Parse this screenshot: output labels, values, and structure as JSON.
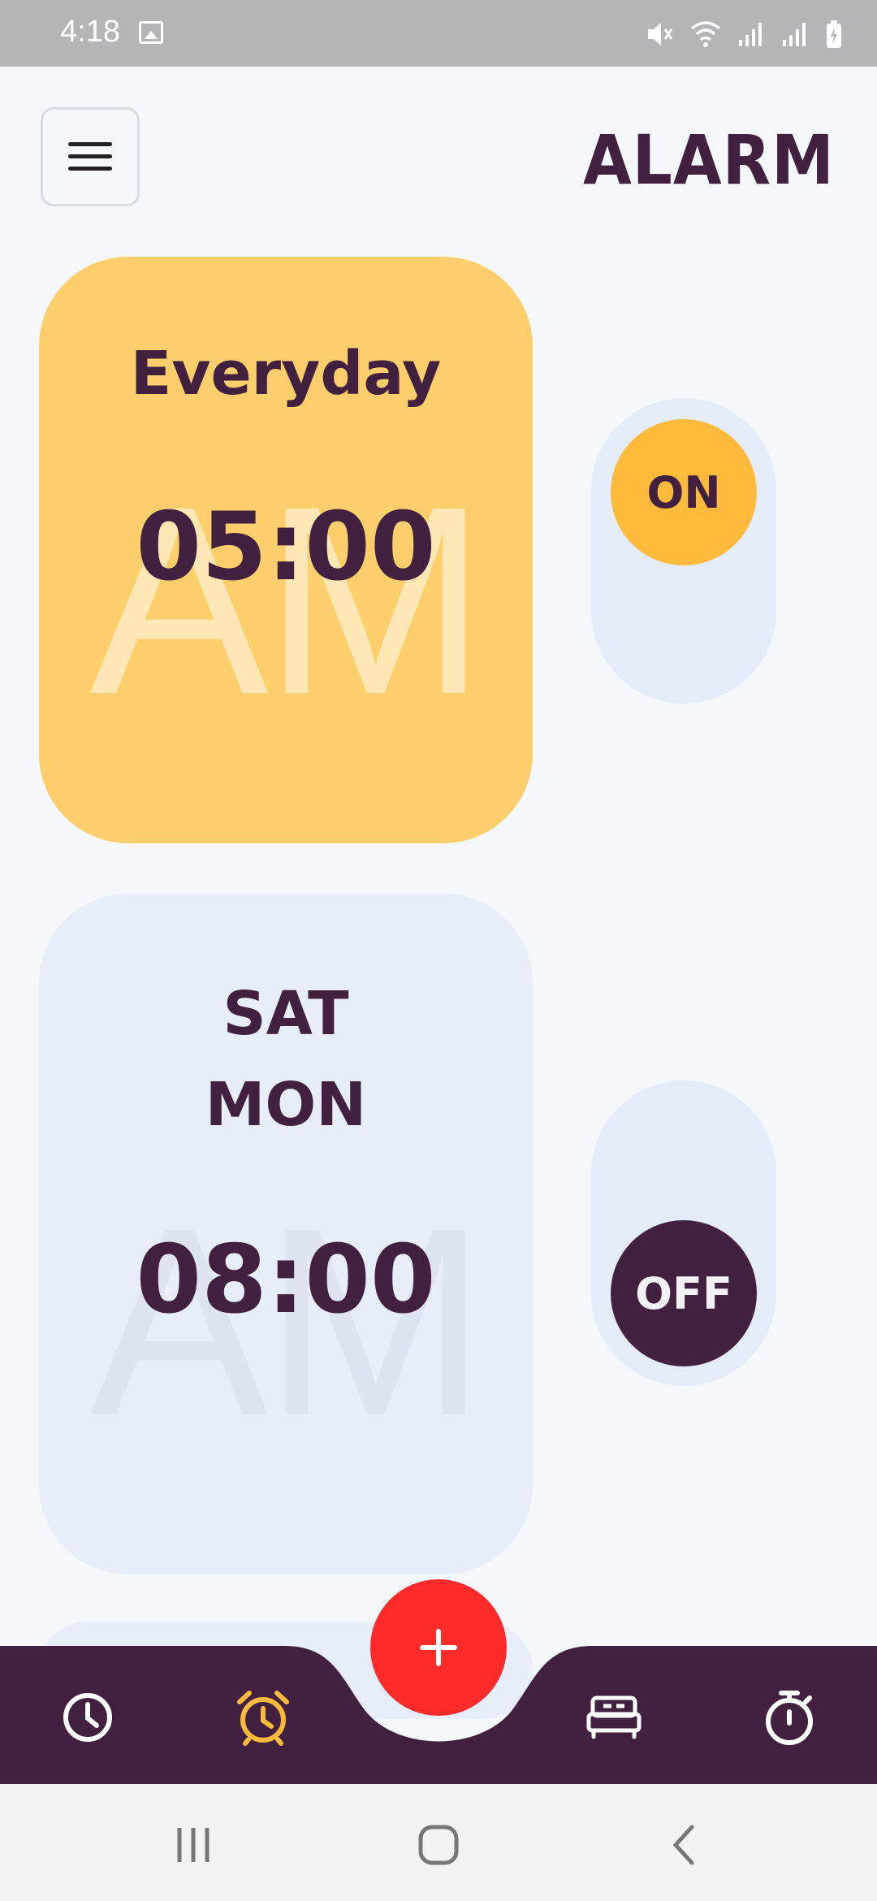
{
  "status_bar": {
    "time": "4:18",
    "icons": [
      "gallery-icon",
      "mute-icon",
      "wifi-icon",
      "signal-icon",
      "signal-icon",
      "battery-charging-icon"
    ]
  },
  "header": {
    "menu_icon": "hamburger-menu-icon",
    "title": "ALARM"
  },
  "alarms": [
    {
      "days": [
        "Everyday"
      ],
      "time": "05:00",
      "period": "AM",
      "toggle_label": "ON",
      "enabled": true,
      "card_color": "#fdcf6c"
    },
    {
      "days": [
        "SAT",
        "MON"
      ],
      "time": "08:00",
      "period": "AM",
      "toggle_label": "OFF",
      "enabled": false,
      "card_color": "#e7edf9"
    }
  ],
  "fab": {
    "label": "+",
    "color": "#ff2a2a"
  },
  "bottom_nav": {
    "background": "#41213f",
    "items": [
      {
        "icon": "clock-icon",
        "active": false
      },
      {
        "icon": "alarm-clock-icon",
        "active": true,
        "color": "#feba3b"
      },
      {
        "icon": "bed-icon",
        "active": false
      },
      {
        "icon": "stopwatch-icon",
        "active": false
      }
    ]
  },
  "system_nav": [
    "recent-apps-icon",
    "home-icon",
    "back-icon"
  ],
  "colors": {
    "accent": "#feba3b",
    "text": "#41213f",
    "background": "#f4f7fc"
  }
}
